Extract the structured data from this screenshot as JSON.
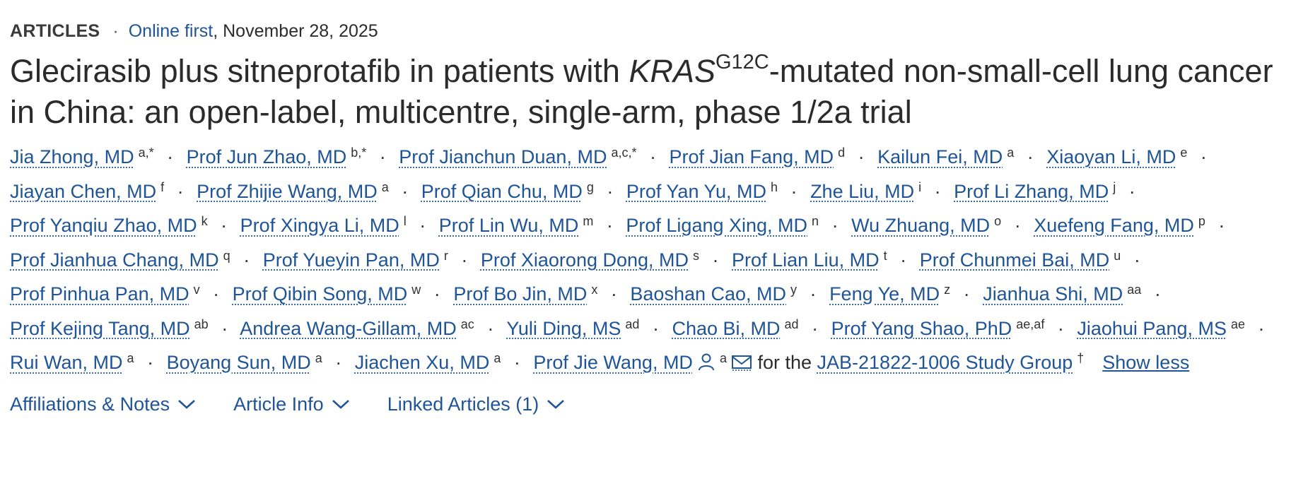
{
  "header": {
    "article_type": "ARTICLES",
    "separator": "·",
    "status_link": "Online first",
    "date": ", November 28, 2025"
  },
  "title": {
    "part1": "Glecirasib plus sitneprotafib in patients with ",
    "gene": "KRAS",
    "mutation": "G12C",
    "part2": "-mutated non-small-cell lung cancer in China: an open-label, multicentre, single-arm, phase 1/2a trial"
  },
  "authors": [
    {
      "name": "Jia Zhong, MD",
      "aff": "a,*"
    },
    {
      "name": "Prof Jun Zhao, MD",
      "aff": "b,*"
    },
    {
      "name": "Prof Jianchun Duan, MD",
      "aff": "a,c,*"
    },
    {
      "name": "Prof Jian Fang, MD",
      "aff": "d"
    },
    {
      "name": "Kailun Fei, MD",
      "aff": "a"
    },
    {
      "name": "Xiaoyan Li, MD",
      "aff": "e"
    },
    {
      "name": "Jiayan Chen, MD",
      "aff": "f"
    },
    {
      "name": "Prof Zhijie Wang, MD",
      "aff": "a"
    },
    {
      "name": "Prof Qian Chu, MD",
      "aff": "g"
    },
    {
      "name": "Prof Yan Yu, MD",
      "aff": "h"
    },
    {
      "name": "Zhe Liu, MD",
      "aff": "i"
    },
    {
      "name": "Prof Li Zhang, MD",
      "aff": "j"
    },
    {
      "name": "Prof Yanqiu Zhao, MD",
      "aff": "k"
    },
    {
      "name": "Prof Xingya Li, MD",
      "aff": "l"
    },
    {
      "name": "Prof Lin Wu, MD",
      "aff": "m"
    },
    {
      "name": "Prof Ligang Xing, MD",
      "aff": "n"
    },
    {
      "name": "Wu Zhuang, MD",
      "aff": "o"
    },
    {
      "name": "Xuefeng Fang, MD",
      "aff": "p"
    },
    {
      "name": "Prof Jianhua Chang, MD",
      "aff": "q"
    },
    {
      "name": "Prof Yueyin Pan, MD",
      "aff": "r"
    },
    {
      "name": "Prof Xiaorong Dong, MD",
      "aff": "s"
    },
    {
      "name": "Prof Lian Liu, MD",
      "aff": "t"
    },
    {
      "name": "Prof Chunmei Bai, MD",
      "aff": "u"
    },
    {
      "name": "Prof Pinhua Pan, MD",
      "aff": "v"
    },
    {
      "name": "Prof Qibin Song, MD",
      "aff": "w"
    },
    {
      "name": "Prof Bo Jin, MD",
      "aff": "x"
    },
    {
      "name": "Baoshan Cao, MD",
      "aff": "y"
    },
    {
      "name": "Feng Ye, MD",
      "aff": "z"
    },
    {
      "name": "Jianhua Shi, MD",
      "aff": "aa"
    },
    {
      "name": "Prof Kejing Tang, MD",
      "aff": "ab"
    },
    {
      "name": "Andrea Wang-Gillam, MD",
      "aff": "ac"
    },
    {
      "name": "Yuli Ding, MS",
      "aff": "ad"
    },
    {
      "name": "Chao Bi, MD",
      "aff": "ad"
    },
    {
      "name": "Prof Yang Shao, PhD",
      "aff": "ae,af"
    },
    {
      "name": "Jiaohui Pang, MS",
      "aff": "ae"
    },
    {
      "name": "Rui Wan, MD",
      "aff": "a"
    },
    {
      "name": "Boyang Sun, MD",
      "aff": "a"
    },
    {
      "name": "Jiachen Xu, MD",
      "aff": "a"
    }
  ],
  "corresponding_author": {
    "name": "Prof Jie Wang, MD",
    "aff": "a",
    "person_icon": "person-icon",
    "mail_icon": "envelope-icon"
  },
  "study_group": {
    "prefix": " for the",
    "name": "JAB-21822-1006 Study Group",
    "aff": "†"
  },
  "show_less": "Show less",
  "tabs": [
    {
      "label": "Affiliations & Notes",
      "icon": "chevron-down-icon"
    },
    {
      "label": "Article Info",
      "icon": "chevron-down-icon"
    },
    {
      "label": "Linked Articles (1)",
      "icon": "chevron-down-icon"
    }
  ],
  "colors": {
    "link": "#1f5596",
    "text": "#2c2c2c"
  }
}
